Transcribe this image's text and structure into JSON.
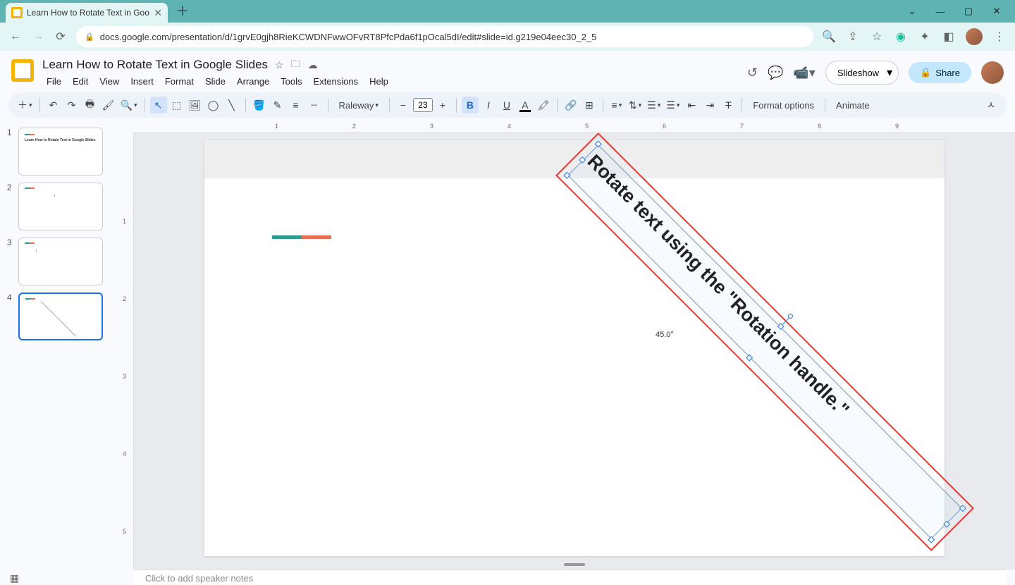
{
  "browser": {
    "tab_title": "Learn How to Rotate Text in Goo",
    "url": "docs.google.com/presentation/d/1grvE0gjh8RieKCWDNFwwOFvRT8PfcPda6f1pOcal5dI/edit#slide=id.g219e04eec30_2_5"
  },
  "doc": {
    "title": "Learn How to Rotate Text in Google Slides",
    "menus": [
      "File",
      "Edit",
      "View",
      "Insert",
      "Format",
      "Slide",
      "Arrange",
      "Tools",
      "Extensions",
      "Help"
    ]
  },
  "header_buttons": {
    "slideshow": "Slideshow",
    "share": "Share"
  },
  "toolbar": {
    "font": "Raleway",
    "size": "23",
    "format_options": "Format options",
    "animate": "Animate"
  },
  "ruler_h": [
    "1",
    "2",
    "3",
    "4",
    "5",
    "6",
    "7",
    "8",
    "9"
  ],
  "ruler_v": [
    "1",
    "2",
    "3",
    "4",
    "5"
  ],
  "slide": {
    "text": "Rotate text using the \"Rotation handle.\"",
    "angle": "45.0°"
  },
  "thumbs": [
    {
      "num": "1",
      "title": "Learn How to Rotate Text in Google Slides"
    },
    {
      "num": "2",
      "title": ""
    },
    {
      "num": "3",
      "title": ""
    },
    {
      "num": "4",
      "title": ""
    }
  ],
  "notes_placeholder": "Click to add speaker notes"
}
